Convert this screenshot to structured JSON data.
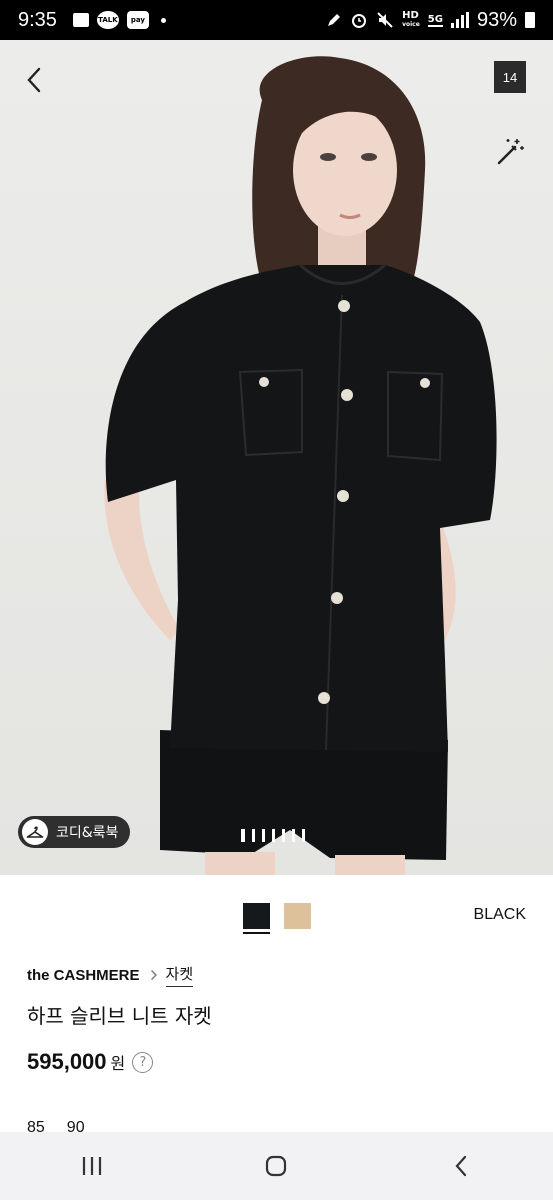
{
  "status_bar": {
    "time": "9:35",
    "talk_label": "TALK",
    "pay_label": "pay",
    "network_label": "HD",
    "network_sub": "voice",
    "gen_label": "5G",
    "battery": "93%"
  },
  "gallery": {
    "image_count": "14",
    "coordi_label": "코디&룩북",
    "page_indicator_count": 7,
    "active_page": 0
  },
  "product": {
    "colors": [
      {
        "name": "BLACK",
        "hex": "#16191c"
      },
      {
        "name": "",
        "hex": "#dcc19b"
      }
    ],
    "selected_color": "BLACK",
    "brand": "the CASHMERE",
    "category": "자켓",
    "name": "하프 슬리브 니트 자켓",
    "price": "595,000",
    "currency": "원",
    "help_glyph": "?",
    "sizes": [
      "85",
      "90"
    ]
  },
  "icons": {
    "back": "chevron-left-icon",
    "magic": "magic-wand-icon",
    "hanger": "hanger-icon",
    "recents": "recent-apps-icon",
    "home": "home-icon",
    "nav_back": "nav-back-icon"
  }
}
